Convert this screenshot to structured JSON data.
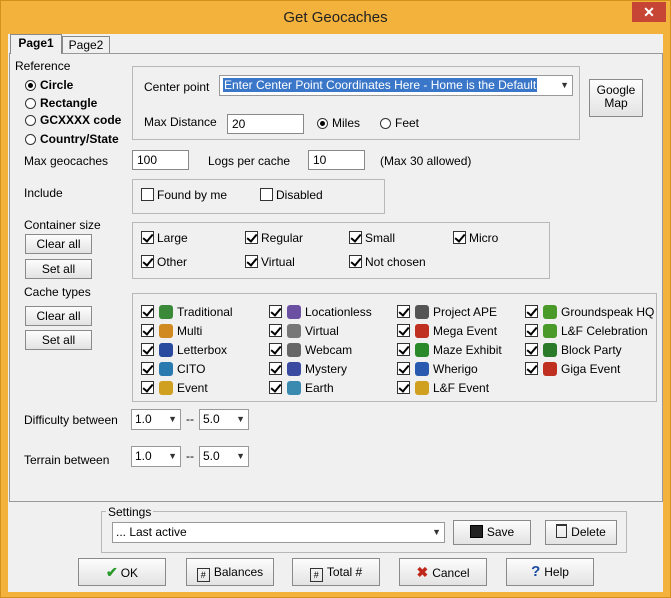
{
  "window": {
    "title": "Get Geocaches",
    "close_glyph": "✕"
  },
  "tabs": [
    {
      "label": "Page1"
    },
    {
      "label": "Page2"
    }
  ],
  "reference": {
    "label": "Reference",
    "options": [
      {
        "label": "Circle",
        "selected": true
      },
      {
        "label": "Rectangle",
        "selected": false
      },
      {
        "label": "GCXXXX code",
        "selected": false
      },
      {
        "label": "Country/State",
        "selected": false
      }
    ],
    "center_point_label": "Center point",
    "center_point_value": "Enter Center Point Coordinates Here - Home is the Default",
    "google_map_label_1": "Google",
    "google_map_label_2": "Map",
    "max_distance_label": "Max Distance",
    "max_distance_value": "20",
    "units": [
      {
        "label": "Miles",
        "selected": true
      },
      {
        "label": "Feet",
        "selected": false
      }
    ]
  },
  "limits": {
    "max_geocaches_label": "Max geocaches",
    "max_geocaches_value": "100",
    "logs_label": "Logs per cache",
    "logs_value": "10",
    "logs_note": "(Max 30 allowed)"
  },
  "include": {
    "label": "Include",
    "options": [
      {
        "label": "Found by me",
        "checked": false
      },
      {
        "label": "Disabled",
        "checked": false
      }
    ]
  },
  "container": {
    "label": "Container size",
    "clear_label": "Clear all",
    "set_label": "Set all",
    "options": [
      {
        "label": "Large",
        "checked": true
      },
      {
        "label": "Regular",
        "checked": true
      },
      {
        "label": "Small",
        "checked": true
      },
      {
        "label": "Micro",
        "checked": true
      },
      {
        "label": "Other",
        "checked": true
      },
      {
        "label": "Virtual",
        "checked": true
      },
      {
        "label": "Not chosen",
        "checked": true
      }
    ]
  },
  "cache_types": {
    "label": "Cache types",
    "clear_label": "Clear all",
    "set_label": "Set all",
    "options": [
      {
        "label": "Traditional",
        "icon": "traditional-icon",
        "checked": true,
        "color": "#3a8a3a"
      },
      {
        "label": "Locationless",
        "icon": "locationless-icon",
        "checked": true,
        "color": "#6b4fa0"
      },
      {
        "label": "Project APE",
        "icon": "project-ape-icon",
        "checked": true,
        "color": "#555555"
      },
      {
        "label": "Groundspeak HQ",
        "icon": "groundspeak-hq-icon",
        "checked": true,
        "color": "#4a9a2a"
      },
      {
        "label": "Multi",
        "icon": "multi-icon",
        "checked": true,
        "color": "#d08a20"
      },
      {
        "label": "Virtual",
        "icon": "virtual-icon",
        "checked": true,
        "color": "#777777"
      },
      {
        "label": "Mega Event",
        "icon": "mega-event-icon",
        "checked": true,
        "color": "#c03020"
      },
      {
        "label": "L&F Celebration",
        "icon": "lf-celebration-icon",
        "checked": true,
        "color": "#4a9a2a"
      },
      {
        "label": "Letterbox",
        "icon": "letterbox-icon",
        "checked": true,
        "color": "#2a4aa0"
      },
      {
        "label": "Webcam",
        "icon": "webcam-icon",
        "checked": true,
        "color": "#666666"
      },
      {
        "label": "Maze Exhibit",
        "icon": "maze-exhibit-icon",
        "checked": true,
        "color": "#2a8a2a"
      },
      {
        "label": "Block Party",
        "icon": "block-party-icon",
        "checked": true,
        "color": "#2a7a2a"
      },
      {
        "label": "CITO",
        "icon": "cito-icon",
        "checked": true,
        "color": "#2a7ab0"
      },
      {
        "label": "Mystery",
        "icon": "mystery-icon",
        "checked": true,
        "color": "#3a4aa0"
      },
      {
        "label": "Wherigo",
        "icon": "wherigo-icon",
        "checked": true,
        "color": "#2a5ab0"
      },
      {
        "label": "Giga Event",
        "icon": "giga-event-icon",
        "checked": true,
        "color": "#c03020"
      },
      {
        "label": "Event",
        "icon": "event-icon",
        "checked": true,
        "color": "#d0a020"
      },
      {
        "label": "Earth",
        "icon": "earth-icon",
        "checked": true,
        "color": "#3a8ab0"
      },
      {
        "label": "L&F Event",
        "icon": "lf-event-icon",
        "checked": true,
        "color": "#d0a020"
      }
    ]
  },
  "difficulty": {
    "label": "Difficulty between",
    "min": "1.0",
    "sep": "--",
    "max": "5.0"
  },
  "terrain": {
    "label": "Terrain between",
    "min": "1.0",
    "sep": "--",
    "max": "5.0"
  },
  "settings": {
    "label": "Settings",
    "value": "... Last active",
    "save_label": "Save",
    "delete_label": "Delete"
  },
  "footer": {
    "ok": "OK",
    "balances": "Balances",
    "total": "Total #",
    "cancel": "Cancel",
    "help": "Help"
  }
}
